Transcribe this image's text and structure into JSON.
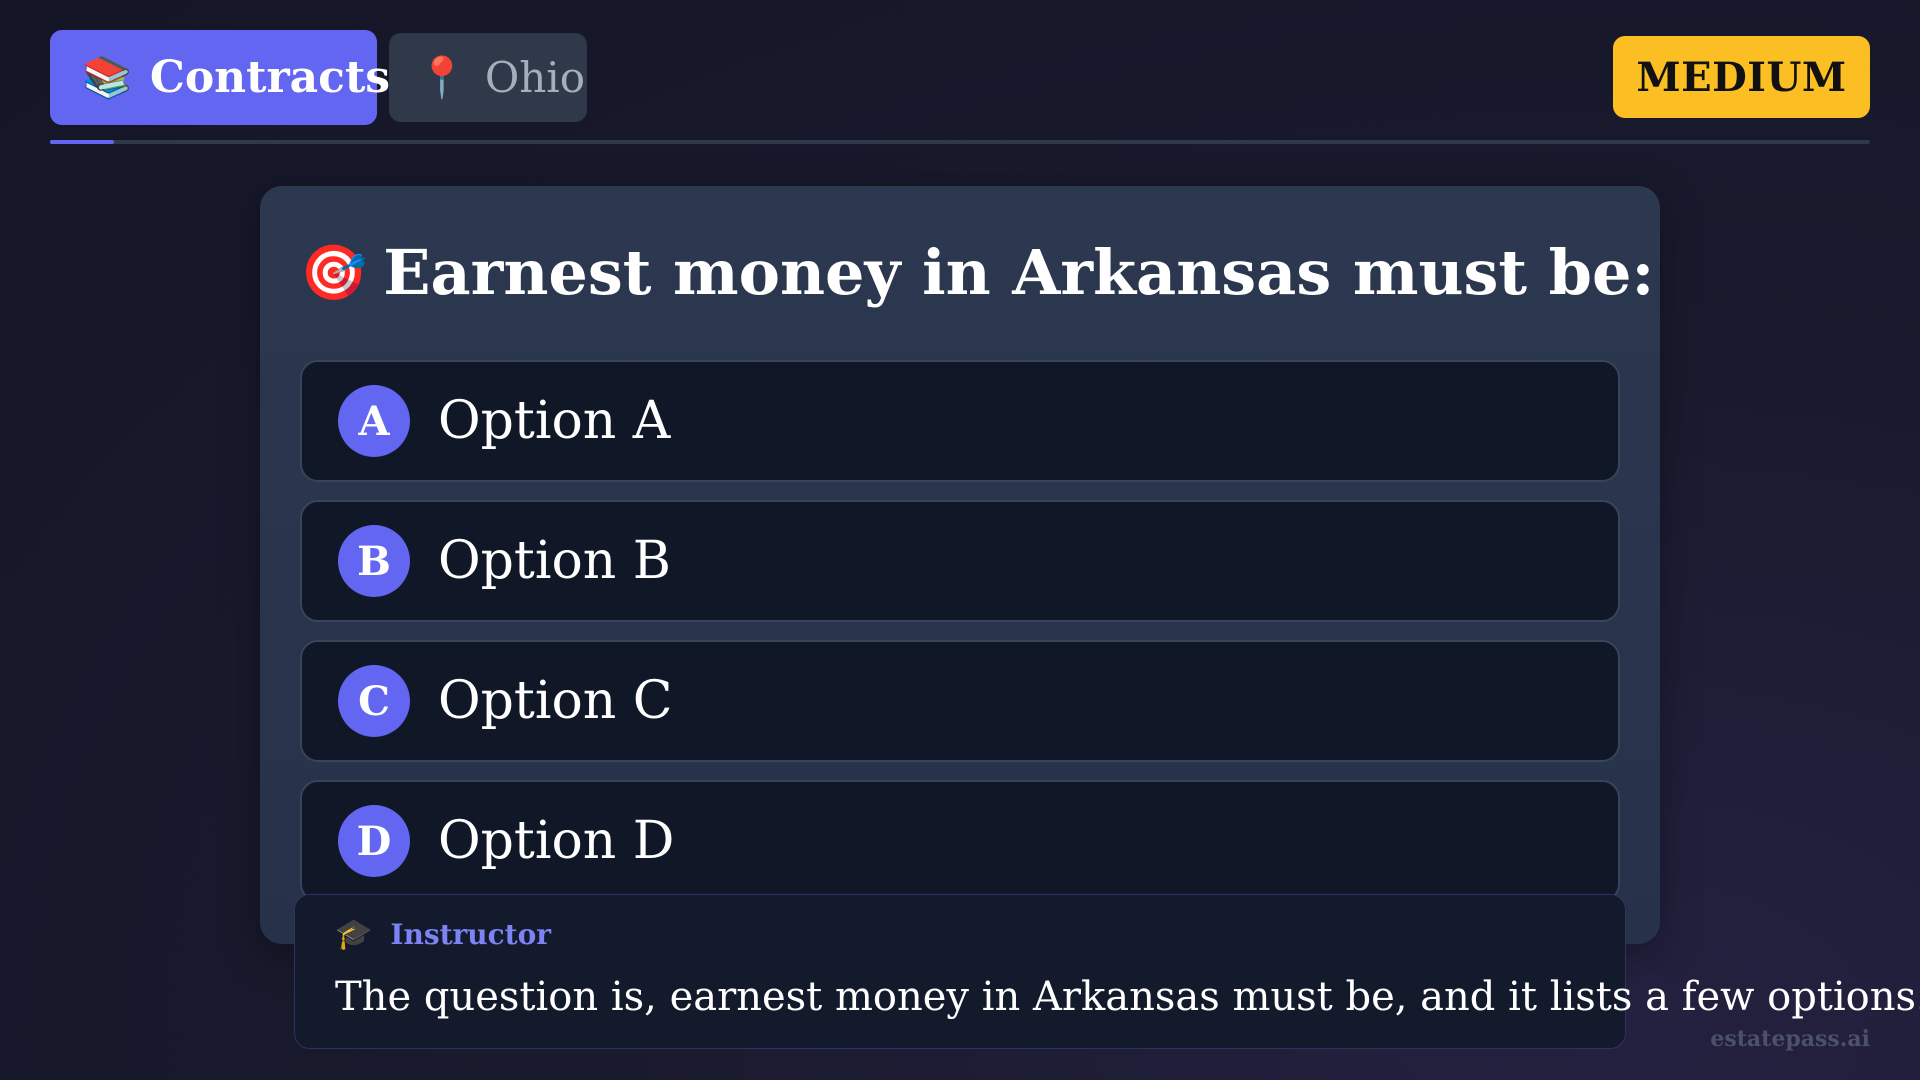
{
  "header": {
    "category": {
      "icon": "books-icon",
      "emoji": "📚",
      "label": "Contracts"
    },
    "location": {
      "icon": "pin-icon",
      "emoji": "📍",
      "label": "Ohio"
    },
    "difficulty": "MEDIUM",
    "progress_fraction": 0.035
  },
  "question": {
    "icon": "target-icon",
    "emoji": "🎯",
    "text": "Earnest money in Arkansas must be:",
    "options": [
      {
        "letter": "A",
        "text": "Option A"
      },
      {
        "letter": "B",
        "text": "Option B"
      },
      {
        "letter": "C",
        "text": "Option C"
      },
      {
        "letter": "D",
        "text": "Option D"
      }
    ]
  },
  "instructor": {
    "icon": "graduation-cap-icon",
    "emoji": "🎓",
    "label": "Instructor",
    "text": "The question is, earnest money in Arkansas must be, and it lists a few options."
  },
  "watermark": "estatepass.ai",
  "colors": {
    "accent": "#6366f1",
    "badge": "#fbbf24",
    "card": "#2c3850",
    "option_bg": "#101828"
  }
}
